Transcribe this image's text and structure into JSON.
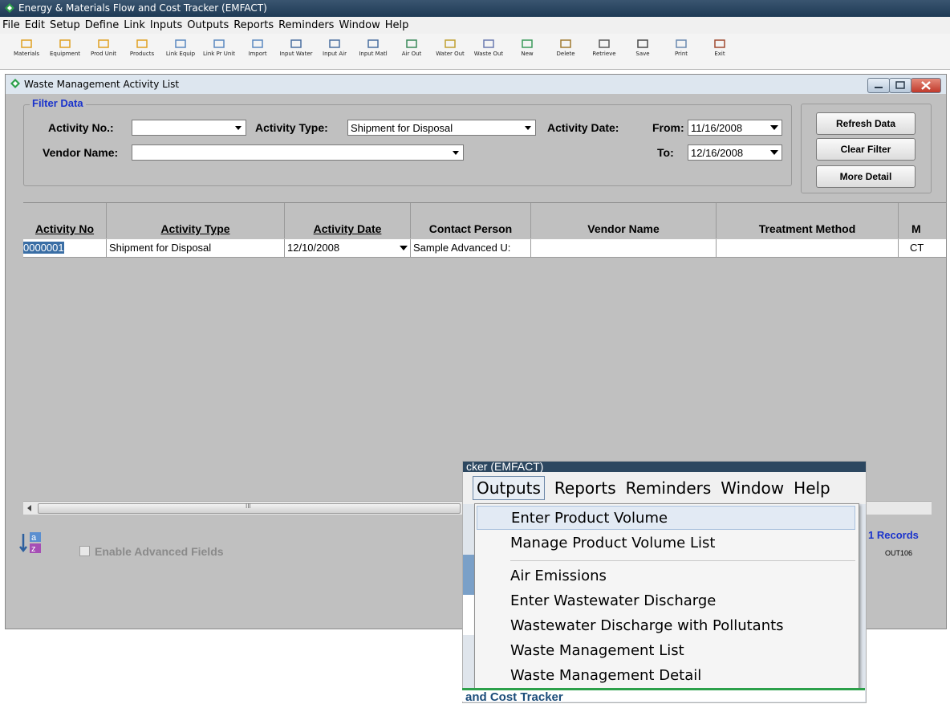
{
  "app": {
    "title": "Energy & Materials Flow and Cost Tracker (EMFACT)"
  },
  "menubar": [
    "File",
    "Edit",
    "Setup",
    "Define",
    "Link",
    "Inputs",
    "Outputs",
    "Reports",
    "Reminders",
    "Window",
    "Help"
  ],
  "toolbar": {
    "buttons": [
      "Materials",
      "Equipment",
      "Prod Unit",
      "Products",
      "Link Equip",
      "Link Pr Unit",
      "Import",
      "Input Water",
      "Input Air",
      "Input Matl",
      "Air Out",
      "Water Out",
      "Waste Out",
      "New",
      "Delete",
      "Retrieve",
      "Save",
      "Print",
      "Exit"
    ]
  },
  "child_window": {
    "title": "Waste Management Activity List",
    "filter": {
      "legend": "Filter Data",
      "activity_no_label": "Activity No.:",
      "activity_no_value": "",
      "activity_type_label": "Activity Type:",
      "activity_type_value": "Shipment for Disposal",
      "activity_date_label": "Activity Date:",
      "from_label": "From:",
      "from_value": "11/16/2008",
      "to_label": "To:",
      "to_value": "12/16/2008",
      "vendor_name_label": "Vendor Name:",
      "vendor_name_value": ""
    },
    "buttons": {
      "refresh": "Refresh Data",
      "clear": "Clear Filter",
      "more": "More Detail"
    },
    "grid": {
      "columns": [
        "Activity No",
        "Activity Type",
        "Activity Date",
        "Contact Person",
        "Vendor Name",
        "Treatment Method",
        "M"
      ],
      "rows": [
        [
          "0000001",
          "Shipment for Disposal",
          "12/10/2008",
          "Sample Advanced U:",
          "",
          "",
          "CT"
        ]
      ]
    },
    "enable_advanced": "Enable Advanced Fields",
    "records": "1 Records",
    "form_id": "OUT106",
    "scroll_glyph": "III"
  },
  "popup": {
    "top_strip": "cker (EMFACT)",
    "menubar": [
      "Outputs",
      "Reports",
      "Reminders",
      "Window",
      "Help"
    ],
    "dropdown": [
      "Enter Product Volume",
      "Manage Product Volume List",
      "Air Emissions",
      "Enter Wastewater Discharge",
      "Wastewater Discharge with Pollutants",
      "Waste Management List",
      "Waste Management Detail"
    ],
    "bottom_text": "and Cost Tracker"
  }
}
